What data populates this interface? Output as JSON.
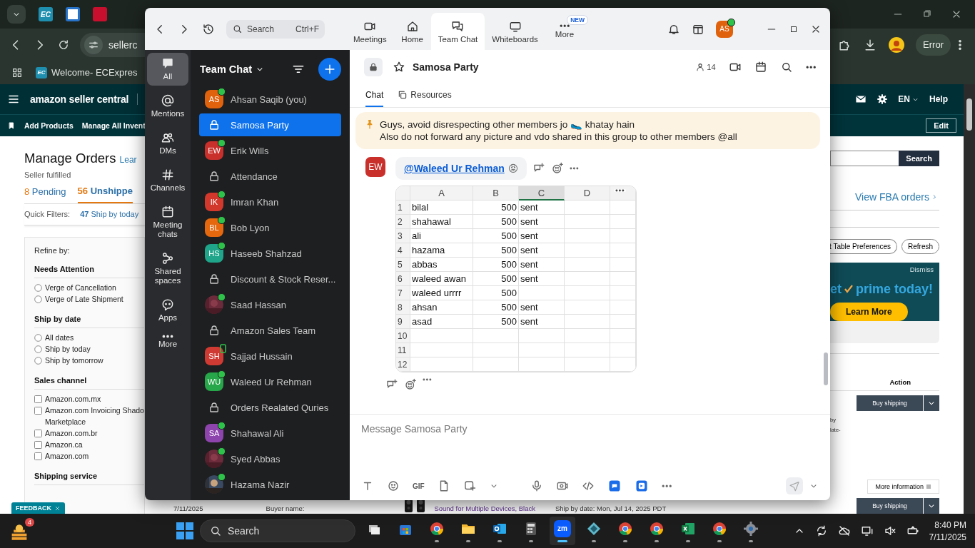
{
  "browser": {
    "tab_icons": [
      {
        "kind": "ec",
        "label": "EC"
      },
      {
        "kind": "square"
      },
      {
        "kind": "red"
      }
    ],
    "url": "sellerc",
    "profile_button": "Error",
    "bookmarks": [
      {
        "icon_label": "EC",
        "label": "Welcome- ECExpres"
      }
    ]
  },
  "seller_central": {
    "logo": "amazon seller central",
    "language": "EN",
    "help": "Help",
    "subnav": [
      "Add Products",
      "Manage All Invent"
    ],
    "edit": "Edit",
    "title": "Manage Orders",
    "learn": "Lear",
    "subtitle": "Seller fulfilled",
    "order_tabs": [
      {
        "count": "8",
        "label": "Pending",
        "selected": false
      },
      {
        "count": "56",
        "label": "Unshippe",
        "selected": true
      }
    ],
    "quick_filters": {
      "label": "Quick Filters:",
      "count": "47",
      "text": "Ship by today"
    },
    "refine_title": "Refine by:",
    "filter_groups": [
      {
        "title": "Needs Attention",
        "kind": "radio",
        "options": [
          {
            "label": "Verge of Cancellation",
            "checked": false
          },
          {
            "label": "Verge of Late Shipment",
            "checked": false
          }
        ]
      },
      {
        "title": "Ship by date",
        "kind": "radio",
        "options": [
          {
            "label": "All dates",
            "checked": false
          },
          {
            "label": "Ship by today",
            "checked": false
          },
          {
            "label": "Ship by tomorrow",
            "checked": false
          }
        ]
      },
      {
        "title": "Sales channel",
        "kind": "checkbox",
        "options": [
          {
            "label": "Amazon.com.mx",
            "checked": false
          },
          {
            "label": "Amazon.com Invoicing Shado",
            "label_line_2": "Marketplace",
            "checked": false
          },
          {
            "label": "Amazon.com.br",
            "checked": false
          },
          {
            "label": "Amazon.ca",
            "checked": false
          },
          {
            "label": "Amazon.com",
            "checked": false
          }
        ]
      },
      {
        "title": "Shipping service"
      }
    ],
    "feedback": "FEEDBACK",
    "search_button": "Search",
    "fba_link": "View FBA orders",
    "table_prefs": "t Table Preferences",
    "refresh": "Refresh",
    "banner": {
      "dismiss": "Dismiss",
      "pre": "et",
      "headline": "prime today!",
      "cta": "Learn More"
    },
    "action_header": "Action",
    "order_rows": [
      {
        "note_1": "by",
        "note_2": "late-",
        "button": "Buy shipping"
      },
      {
        "more_info": "More information",
        "button": "Buy shipping"
      }
    ],
    "bottom_row": {
      "date": "7/11/2025",
      "buyer": "Buyer name:",
      "product": "Sound for Multiple Devices, Black",
      "ship_by": "Ship by date: Mon, Jul 14, 2025 PDT"
    }
  },
  "zoom": {
    "search": {
      "placeholder": "Search",
      "shortcut": "Ctrl+F"
    },
    "nav_tabs": [
      {
        "kind": "meetings",
        "label": "Meetings",
        "selected": false
      },
      {
        "kind": "home",
        "label": "Home",
        "selected": false
      },
      {
        "kind": "chat",
        "label": "Team Chat",
        "selected": true
      },
      {
        "kind": "whiteboards",
        "label": "Whiteboards",
        "selected": false
      },
      {
        "kind": "more",
        "label": "More",
        "badge": "NEW",
        "selected": false
      }
    ],
    "profile": {
      "initials": "AS",
      "online": true
    },
    "rail": [
      {
        "kind": "all",
        "label": "All",
        "selected": true
      },
      {
        "kind": "mentions",
        "label": "Mentions",
        "selected": false
      },
      {
        "kind": "dms",
        "label": "DMs",
        "selected": false
      },
      {
        "kind": "channels",
        "label": "Channels",
        "selected": false
      },
      {
        "kind": "meeting_chats",
        "label": "Meeting chats",
        "selected": false
      },
      {
        "kind": "shared",
        "label": "Shared spaces",
        "selected": false
      },
      {
        "kind": "apps",
        "label": "Apps",
        "selected": false
      },
      {
        "kind": "more",
        "label": "More",
        "selected": false
      }
    ],
    "list_title": "Team Chat",
    "chats": [
      {
        "kind": "person",
        "initials": "AS",
        "color": "#e0620d",
        "name": "Ahsan Saqib (you)",
        "online": true,
        "selected": false
      },
      {
        "kind": "channel",
        "name": "Samosa Party",
        "selected": true
      },
      {
        "kind": "person",
        "initials": "EW",
        "color": "#c9302c",
        "name": "Erik Wills",
        "online": true,
        "selected": false
      },
      {
        "kind": "channel",
        "name": "Attendance",
        "selected": false
      },
      {
        "kind": "person",
        "initials": "IK",
        "color": "#d2392c",
        "name": "Imran Khan",
        "online": true,
        "selected": false
      },
      {
        "kind": "person",
        "initials": "BL",
        "color": "#e5680f",
        "name": "Bob Lyon",
        "online": true,
        "selected": false
      },
      {
        "kind": "person",
        "initials": "HS",
        "color": "#1fa58a",
        "name": "Haseeb Shahzad",
        "online": true,
        "selected": false
      },
      {
        "kind": "channel",
        "name": "Discount & Stock Reser...",
        "selected": false
      },
      {
        "name": "Saad Hassan",
        "online": true,
        "selected": false
      },
      {
        "kind": "channel",
        "name": "Amazon Sales Team",
        "selected": false
      },
      {
        "kind": "person",
        "initials": "SH",
        "color": "#cf3b32",
        "name": "Sajjad Hussain",
        "on_mobile": true,
        "selected": false
      },
      {
        "kind": "person",
        "initials": "WU",
        "color": "#27a64a",
        "name": "Waleed Ur Rehman",
        "online": true,
        "selected": false
      },
      {
        "kind": "channel",
        "name": "Orders Realated Quries",
        "selected": false
      },
      {
        "kind": "person",
        "initials": "SA",
        "color": "#8e44ad",
        "name": "Shahawal Ali",
        "online": true,
        "selected": false
      },
      {
        "name": "Syed Abbas",
        "online": true,
        "selected": false
      },
      {
        "name": "Hazama Nazir",
        "online": true,
        "selected": false
      }
    ],
    "channel": {
      "name": "Samosa Party",
      "members": "14",
      "tabs": [
        {
          "kind": "chat",
          "label": "Chat",
          "selected": true
        },
        {
          "kind": "resources",
          "label": "Resources",
          "selected": false
        }
      ]
    },
    "pinned": [
      "Guys, avoid disrespecting other members jo 🥿 khatay hain",
      "Also do not forward any picture and vdo shared in this group to other members @all"
    ],
    "message": {
      "initials": "EW",
      "mention": "@Waleed Ur Rehman",
      "emoji": "😡",
      "sheet": {
        "columns": [
          {
            "label": "A",
            "selected": false
          },
          {
            "label": "B",
            "selected": false
          },
          {
            "label": "C",
            "selected": true
          },
          {
            "label": "D",
            "selected": false
          }
        ],
        "rows": [
          {
            "num": "1",
            "a": "bilal",
            "b": "500",
            "c": "sent"
          },
          {
            "num": "2",
            "a": "shahawal",
            "b": "500",
            "c": "sent"
          },
          {
            "num": "3",
            "a": "ali",
            "b": "500",
            "c": "sent"
          },
          {
            "num": "4",
            "a": "hazama",
            "b": "500",
            "c": "sent"
          },
          {
            "num": "5",
            "a": "abbas",
            "b": "500",
            "c": "sent"
          },
          {
            "num": "6",
            "a": "waleed awan",
            "b": "500",
            "c": "sent"
          },
          {
            "num": "7",
            "a": "waleed urrrr",
            "b": "500"
          },
          {
            "num": "8",
            "a": "ahsan",
            "b": "500",
            "c": "sent"
          },
          {
            "num": "9",
            "a": "asad",
            "b": "500",
            "c": "sent"
          },
          {
            "num": "10"
          },
          {
            "num": "11"
          },
          {
            "num": "12"
          }
        ]
      }
    },
    "composer": {
      "placeholder": "Message Samosa Party",
      "gif": "GIF"
    }
  },
  "taskbar": {
    "widget_badge": "4",
    "search": "Search",
    "apps": [
      {
        "kind": "taskview",
        "running": false,
        "selected": false
      },
      {
        "kind": "store",
        "running": false,
        "selected": false
      },
      {
        "kind": "chrome",
        "running": true,
        "selected": false
      },
      {
        "kind": "files",
        "running": true,
        "selected": false
      },
      {
        "kind": "outlook",
        "running": true,
        "selected": false
      },
      {
        "kind": "calculator",
        "running": true,
        "selected": false
      },
      {
        "kind": "zoom",
        "label": "zm",
        "running": true,
        "selected": true
      },
      {
        "kind": "diamond",
        "running": true,
        "selected": false
      },
      {
        "kind": "chrome",
        "running": true,
        "selected": false
      },
      {
        "kind": "chrome",
        "running": true,
        "selected": false
      },
      {
        "kind": "excel",
        "running": true,
        "selected": false
      },
      {
        "kind": "chrome",
        "running": true,
        "selected": false
      },
      {
        "kind": "settings",
        "running": true,
        "selected": false
      }
    ],
    "time": "8:40 PM",
    "date": "7/11/2025"
  }
}
